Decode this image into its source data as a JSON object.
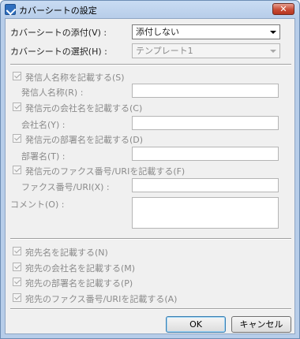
{
  "window": {
    "title": "カバーシートの設定",
    "close_glyph": "✕"
  },
  "attach": {
    "label": "カバーシートの添付(V) :",
    "value": "添付しない"
  },
  "template": {
    "label": "カバーシートの選択(H) :",
    "value": "テンプレート1"
  },
  "sender": {
    "name_checkbox": "発信人名称を記載する(S)",
    "name_label": "発信人名称(R) :",
    "company_checkbox": "発信元の会社名を記載する(C)",
    "company_label": "会社名(Y) :",
    "dept_checkbox": "発信元の部署名を記載する(D)",
    "dept_label": "部署名(T) :",
    "fax_checkbox": "発信元のファクス番号/URIを記載する(F)",
    "fax_label": "ファクス番号/URI(X) :",
    "comment_label": "コメント(O) :"
  },
  "recipient": {
    "name_checkbox": "宛先名を記載する(N)",
    "company_checkbox": "宛先の会社名を記載する(M)",
    "dept_checkbox": "宛先の部署名を記載する(P)",
    "fax_checkbox": "宛先のファクス番号/URIを記載する(A)"
  },
  "buttons": {
    "ok": "OK",
    "cancel": "キャンセル"
  }
}
